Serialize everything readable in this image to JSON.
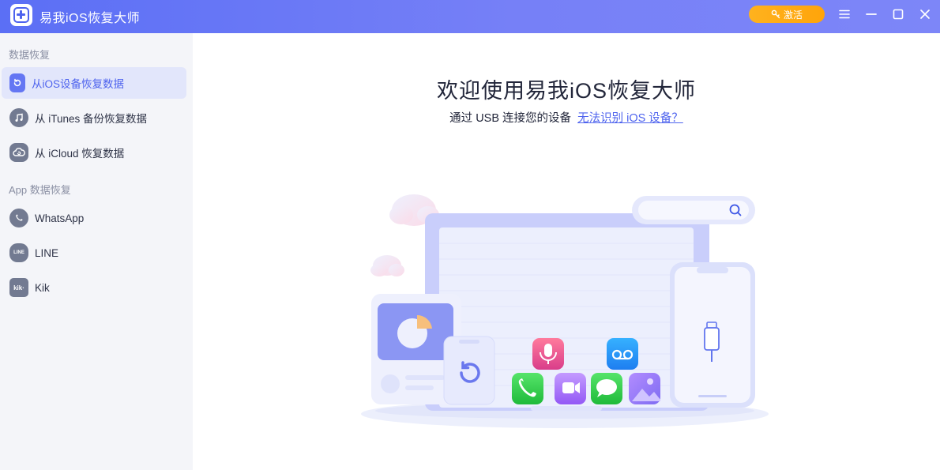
{
  "titlebar": {
    "app_title": "易我iOS恢复大师",
    "activate_label": "激活",
    "icons": [
      "app-logo-icon",
      "key-icon",
      "menu-icon",
      "minimize-icon",
      "maximize-icon",
      "close-icon"
    ]
  },
  "sidebar": {
    "data_section_title": "数据恢复",
    "data_items": [
      {
        "label": "从iOS设备恢复数据",
        "icon": "device-restore-icon",
        "active": true
      },
      {
        "label": "从 iTunes 备份恢复数据",
        "icon": "itunes-icon",
        "active": false
      },
      {
        "label": "从 iCloud 恢复数据",
        "icon": "icloud-icon",
        "active": false
      }
    ],
    "app_section_title": "App 数据恢复",
    "app_items": [
      {
        "label": "WhatsApp",
        "icon": "whatsapp-icon"
      },
      {
        "label": "LINE",
        "icon": "line-icon"
      },
      {
        "label": "Kik",
        "icon": "kik-icon"
      }
    ]
  },
  "main": {
    "title": "欢迎使用易我iOS恢复大师",
    "subtitle": "通过 USB 连接您的设备",
    "help_link": "无法识别 iOS 设备？",
    "line_icon_text": "LINE",
    "kik_icon_text": "kik·"
  },
  "colors": {
    "accent": "#4e63ee",
    "titlebar_start": "#5b6ff5",
    "titlebar_end": "#7d86f8",
    "activate": "#ffa40a",
    "sidebar_bg": "#f4f5f9",
    "active_bg": "#e2e6fb"
  }
}
